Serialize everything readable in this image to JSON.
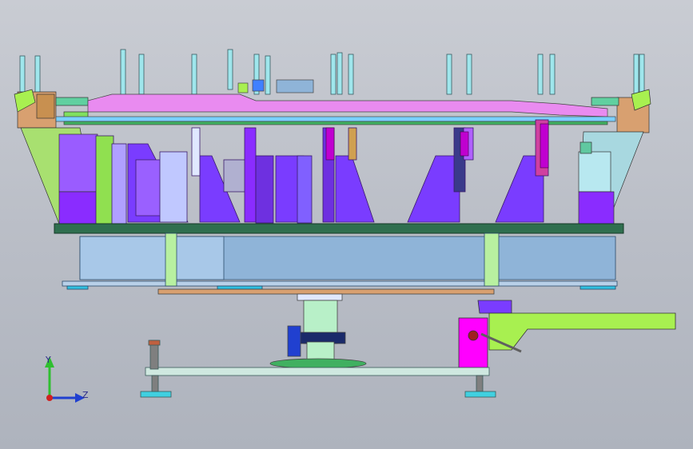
{
  "viewport": {
    "background_top": "#c9ccd3",
    "background_bottom": "#aeb3bd"
  },
  "triad": {
    "y_label": "Y",
    "z_label": "Z",
    "y_color": "#2fbf2f",
    "z_color": "#2040d0",
    "origin_color": "#d02020"
  },
  "colors": {
    "base_plate": "#2f6f4f",
    "beam_blue": "#8fb4d8",
    "gusset_purple": "#7a3cff",
    "block_magenta": "#ff00ff",
    "arm_green": "#a8f050",
    "panel_pink": "#e98bf0",
    "post_cyan": "#8fe8e8",
    "plate_light": "#cfe8e0",
    "tan": "#d8a070"
  }
}
